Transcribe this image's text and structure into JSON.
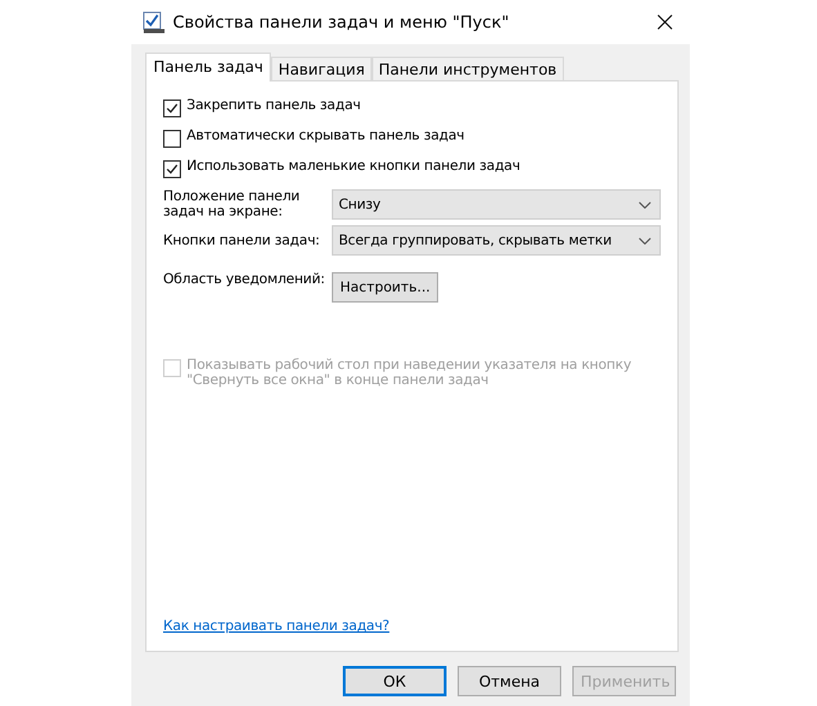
{
  "window": {
    "title": "Свойства панели задач и меню \"Пуск\""
  },
  "tabs": [
    {
      "label": "Панель задач",
      "selected": true
    },
    {
      "label": "Навигация",
      "selected": false
    },
    {
      "label": "Панели инструментов",
      "selected": false
    }
  ],
  "options": [
    {
      "label": "Закрепить панель задач",
      "checked": true,
      "disabled": false
    },
    {
      "label": "Автоматически скрывать панель задач",
      "checked": false,
      "disabled": false
    },
    {
      "label": "Использовать маленькие кнопки панели задач",
      "checked": true,
      "disabled": false
    }
  ],
  "settings": [
    {
      "kind": "dropdown",
      "label": "Положение панели задач на экране:",
      "value": "Снизу"
    },
    {
      "kind": "dropdown",
      "label": "Кнопки панели задач:",
      "value": "Всегда группировать, скрывать метки"
    },
    {
      "kind": "button",
      "label": "Область уведомлений:",
      "value": "Настроить..."
    }
  ],
  "peek": {
    "label": "Показывать рабочий стол при наведении указателя на кнопку \"Свернуть все окна\" в конце панели задач",
    "checked": false,
    "disabled": true
  },
  "help_link": "Как настраивать панели задач?",
  "buttons": [
    {
      "label": "ОК",
      "default": true,
      "disabled": false
    },
    {
      "label": "Отмена",
      "default": false,
      "disabled": false
    },
    {
      "label": "Применить",
      "default": false,
      "disabled": true
    }
  ]
}
